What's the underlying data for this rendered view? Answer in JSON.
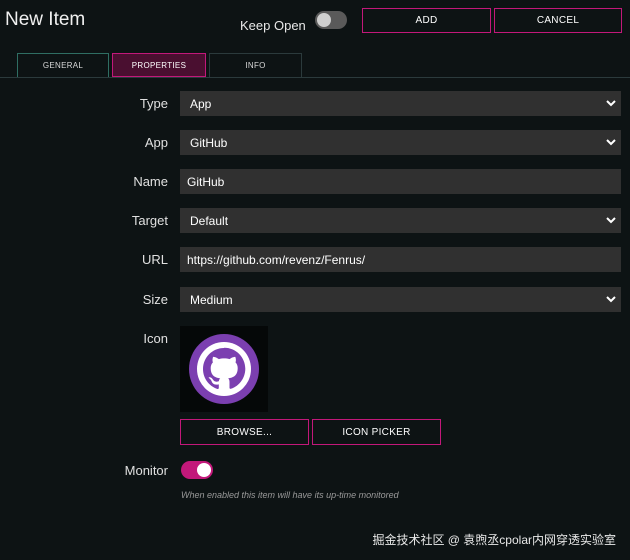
{
  "header": {
    "title": "New Item",
    "keep_open_label": "Keep Open",
    "keep_open_enabled": false,
    "add_label": "ADD",
    "cancel_label": "CANCEL"
  },
  "tabs": [
    {
      "label": "GENERAL"
    },
    {
      "label": "PROPERTIES",
      "active": true
    },
    {
      "label": "INFO"
    }
  ],
  "form": {
    "type": {
      "label": "Type",
      "value": "App"
    },
    "app": {
      "label": "App",
      "value": "GitHub"
    },
    "name": {
      "label": "Name",
      "value": "GitHub"
    },
    "target": {
      "label": "Target",
      "value": "Default"
    },
    "url": {
      "label": "URL",
      "value": "https://github.com/revenz/Fenrus/"
    },
    "size": {
      "label": "Size",
      "value": "Medium"
    },
    "icon": {
      "label": "Icon",
      "image": "github-icon",
      "browse_label": "BROWSE...",
      "picker_label": "ICON PICKER"
    },
    "monitor": {
      "label": "Monitor",
      "enabled": true,
      "help": "When enabled this item will have its up-time monitored"
    }
  },
  "watermark": "掘金技术社区 @ 袁煦丞cpolar内网穿透实验室",
  "colors": {
    "accent": "#c2187a",
    "background": "#0d1314",
    "field": "#303030",
    "github_purple": "#7b3fb0"
  }
}
